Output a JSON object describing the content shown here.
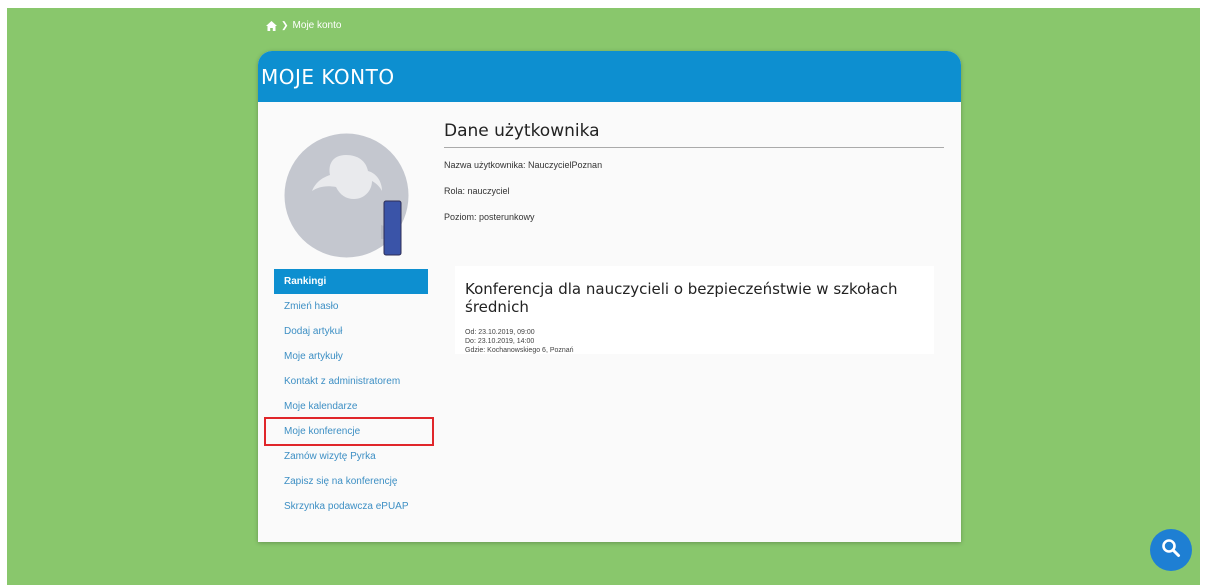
{
  "breadcrumb": {
    "current": "Moje konto"
  },
  "header": {
    "title": "MOJE KONTO"
  },
  "user_data": {
    "title": "Dane użytkownika",
    "username": "Nazwa użytkownika: NauczycielPoznan",
    "role": "Rola: nauczyciel",
    "level": "Poziom: posterunkowy"
  },
  "sidebar": {
    "items": [
      {
        "label": "Rankingi"
      },
      {
        "label": "Zmień hasło"
      },
      {
        "label": "Dodaj artykuł"
      },
      {
        "label": "Moje artykuły"
      },
      {
        "label": "Kontakt z administratorem"
      },
      {
        "label": "Moje kalendarze"
      },
      {
        "label": "Moje konferencje"
      },
      {
        "label": "Zamów wizytę Pyrka"
      },
      {
        "label": "Zapisz się na konferencję"
      },
      {
        "label": "Skrzynka podawcza ePUAP"
      }
    ]
  },
  "conference": {
    "title": "Konferencja dla nauczycieli o bezpieczeństwie w szkołach średnich",
    "from": "Od: 23.10.2019, 09:00",
    "to": "Do: 23.10.2019, 14:00",
    "where": "Gdzie: Kochanowskiego 6, Poznań"
  },
  "colors": {
    "background": "#89c76c",
    "accent": "#0d8fd0",
    "link": "#3d8fc4",
    "highlight_border": "#e0262a"
  },
  "icons": {
    "home": "home-icon",
    "search": "search-icon"
  }
}
